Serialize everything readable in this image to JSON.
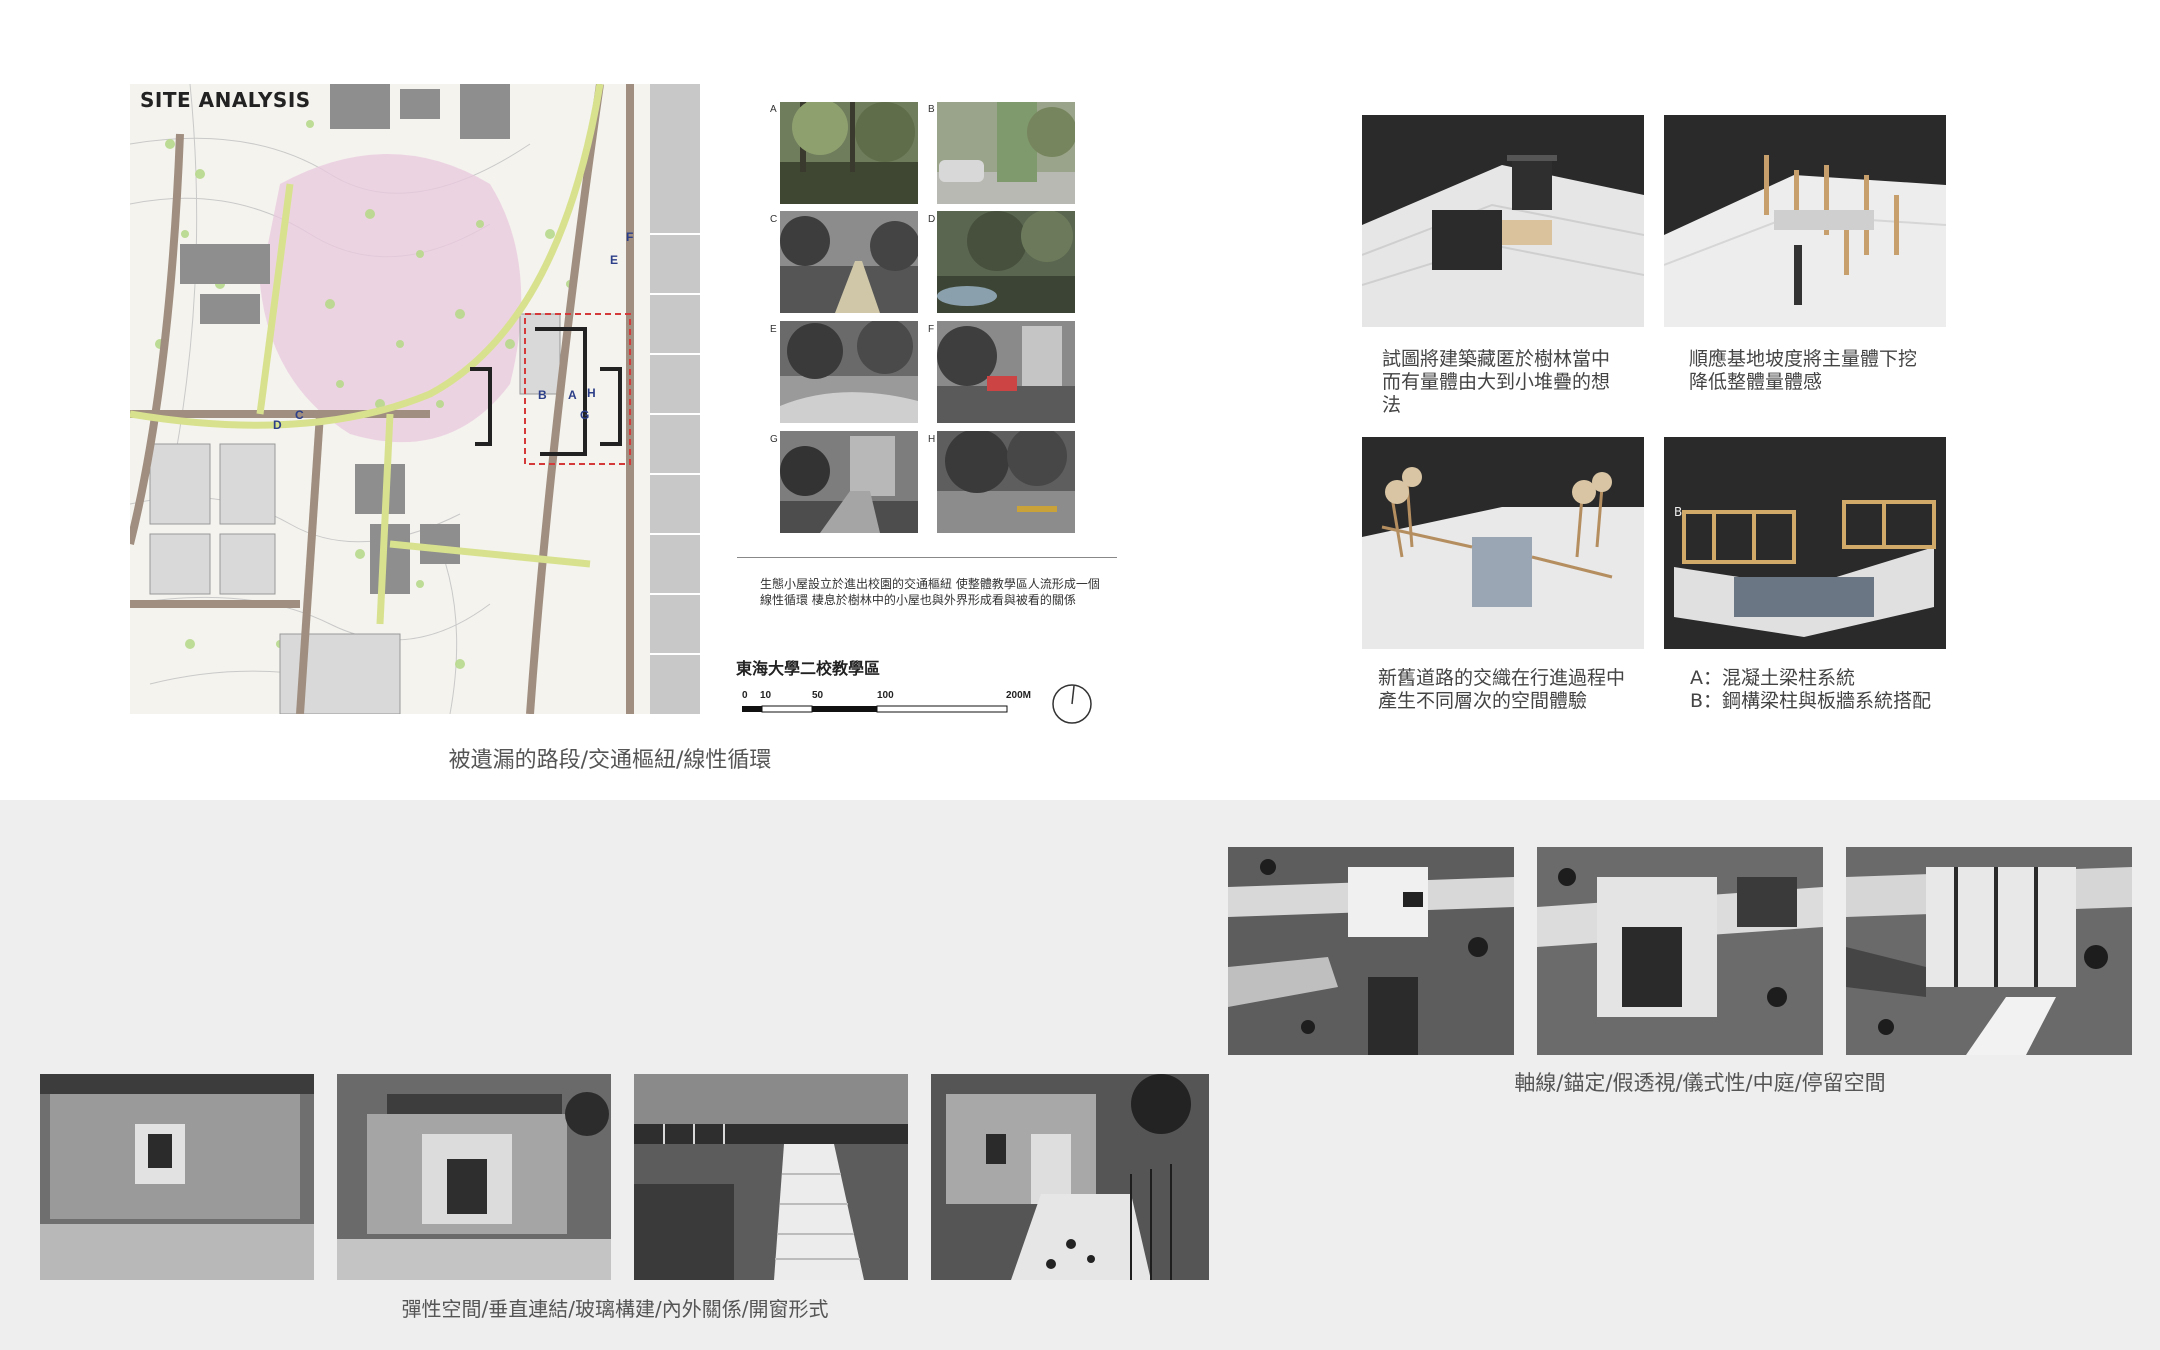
{
  "site_analysis": {
    "title": "SITE ANALYSIS",
    "caption": "被遺漏的路段/交通樞紐/線性循環",
    "map_letters": [
      "A",
      "B",
      "C",
      "D",
      "E",
      "F",
      "G",
      "H"
    ]
  },
  "site_photos": {
    "labels": [
      "A",
      "B",
      "C",
      "D",
      "E",
      "F",
      "G",
      "H"
    ],
    "description": "生態小屋設立於進出校園的交通樞紐 使整體教學區人流形成一個線性循環 棲息於樹林中的小屋也與外界形成看與被看的關係",
    "campus_title": "東海大學二校教學區",
    "scale_ticks": [
      "0",
      "10",
      "50",
      "100",
      "200M"
    ]
  },
  "models": {
    "captions": [
      "試圖將建築藏匿於樹林當中而有量體由大到小堆疊的想法",
      "順應基地坡度將主量體下挖降低整體量體感",
      "新舊道路的交織在行進過程中產生不同層次的空間體驗",
      "A：混凝土梁柱系統\nB：鋼構梁柱與板牆系統搭配"
    ],
    "model_label_b": "B"
  },
  "bottom": {
    "right_caption": "軸線/錨定/假透視/儀式性/中庭/停留空間",
    "left_caption": "彈性空間/垂直連結/玻璃構建/內外關係/開窗形式"
  }
}
